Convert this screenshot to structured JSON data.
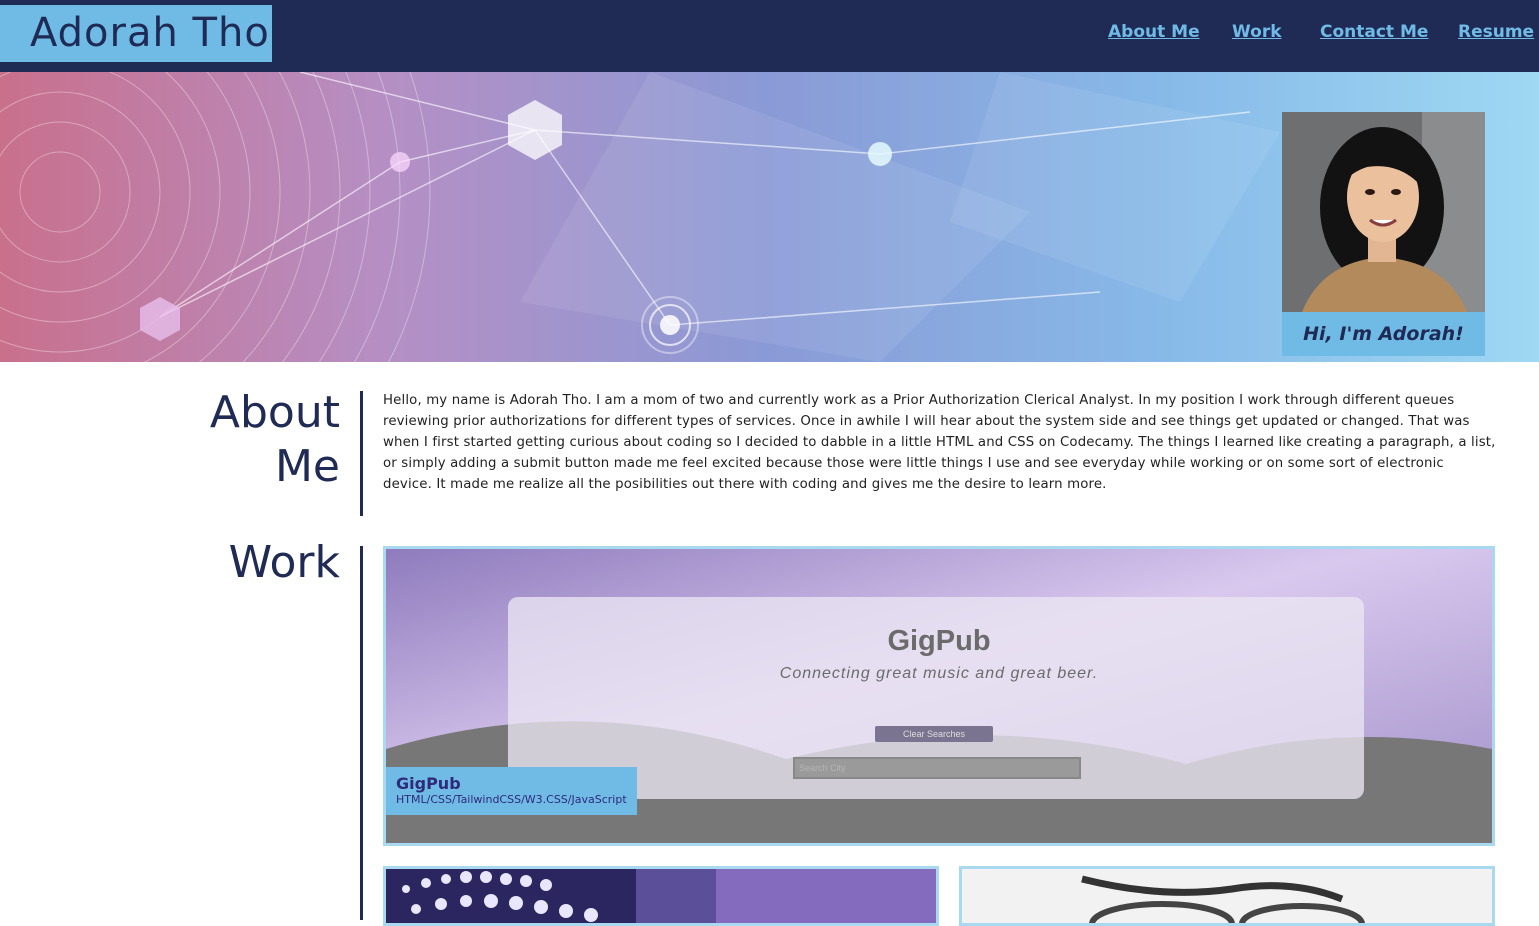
{
  "header": {
    "brand": "Adorah Tho",
    "nav": [
      "About Me",
      "Work",
      "Contact Me",
      "Resume"
    ]
  },
  "hero": {
    "greeting": "Hi, I'm Adorah!"
  },
  "about": {
    "title_line1": "About",
    "title_line2": "Me",
    "text": "Hello, my name is Adorah Tho. I am a mom of two and currently work as a Prior Authorization Clerical Analyst. In my position I work through different queues reviewing prior authorizations for different types of services. Once in awhile I will hear about the system side and see things get updated or changed. That was when I first started getting curious about coding so I decided to dabble in a little HTML and CSS on Codecamy. The things I learned like creating a paragraph, a list, or simply adding a submit button made me feel excited because those were little things I use and see everyday while working or on some sort of electronic device. It made me realize all the posibilities out there with coding and gives me the desire to learn more."
  },
  "work": {
    "title": "Work",
    "featured": {
      "name": "GigPub",
      "tech": "HTML/CSS/TailwindCSS/W3.CSS/JavaScript",
      "screenshot": {
        "app_title": "GigPub",
        "tagline": "Connecting great music and great beer.",
        "button": "Clear Searches",
        "search_placeholder": "Search City"
      }
    }
  }
}
